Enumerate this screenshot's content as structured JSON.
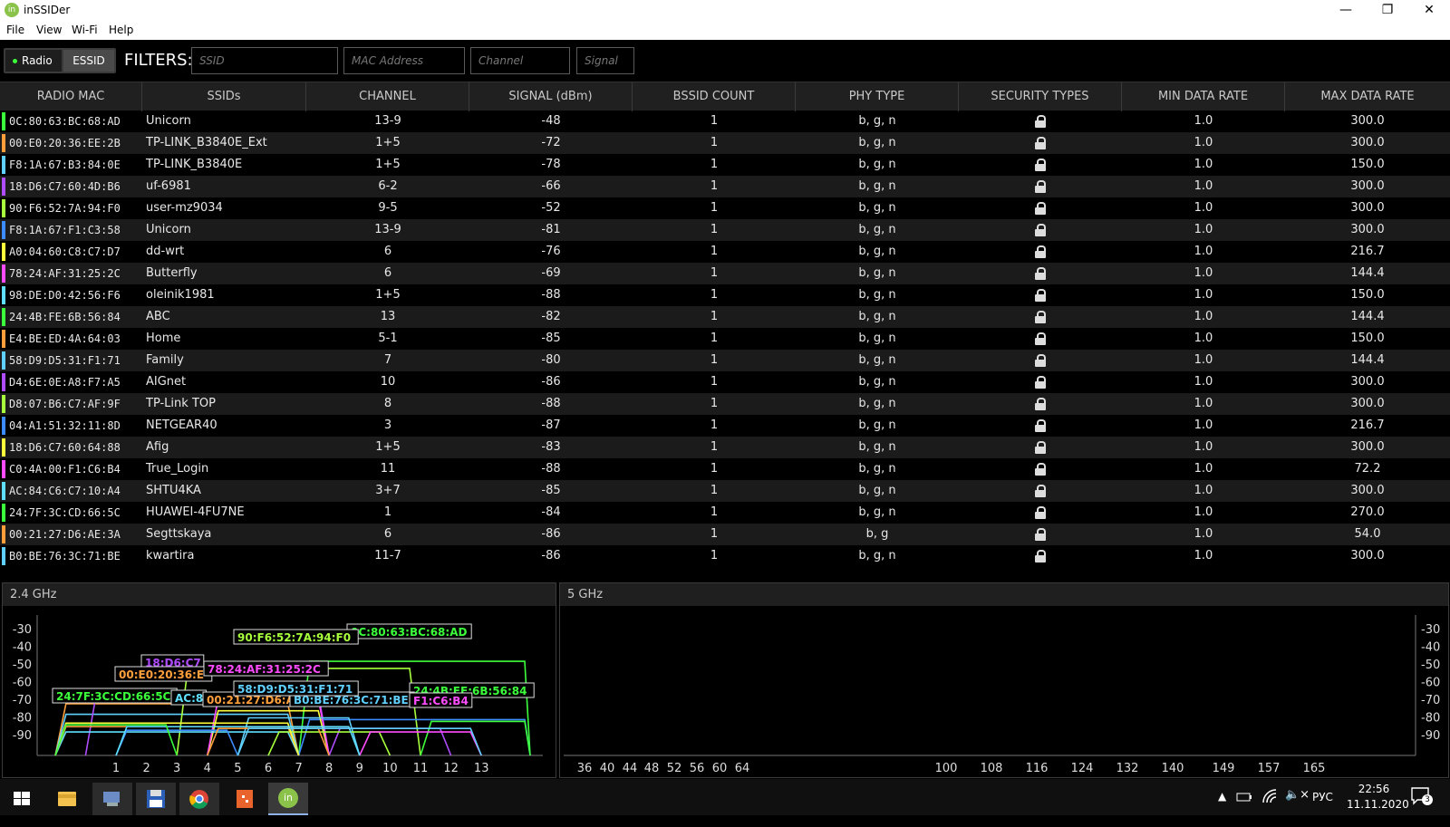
{
  "window": {
    "title": "inSSIDer",
    "icon_label": "in"
  },
  "menu": [
    "File",
    "View",
    "Wi-Fi",
    "Help"
  ],
  "toolbar": {
    "radio_label": "Radio",
    "essid_label": "ESSID",
    "filters_label": "FILTERS:",
    "ssid_placeholder": "SSID",
    "mac_placeholder": "MAC Address",
    "channel_placeholder": "Channel",
    "signal_placeholder": "Signal"
  },
  "columns": [
    "RADIO MAC",
    "SSIDs",
    "CHANNEL",
    "SIGNAL (dBm)",
    "BSSID COUNT",
    "PHY TYPE",
    "SECURITY TYPES",
    "MIN DATA RATE",
    "MAX DATA RATE"
  ],
  "rows": [
    {
      "mac": "0C:80:63:BC:68:AD",
      "ssid": "Unicorn",
      "channel": "13-9",
      "signal": "-48",
      "bssid": "1",
      "phy": "b, g, n",
      "min": "1.0",
      "max": "300.0",
      "color": "#3cff3c"
    },
    {
      "mac": "00:E0:20:36:EE:2B",
      "ssid": "TP-LINK_B3840E_Ext",
      "channel": "1+5",
      "signal": "-72",
      "bssid": "1",
      "phy": "b, g, n",
      "min": "1.0",
      "max": "300.0",
      "color": "#ff9f3c"
    },
    {
      "mac": "F8:1A:67:B3:84:0E",
      "ssid": "TP-LINK_B3840E",
      "channel": "1+5",
      "signal": "-78",
      "bssid": "1",
      "phy": "b, g, n",
      "min": "1.0",
      "max": "150.0",
      "color": "#5fd0ff"
    },
    {
      "mac": "18:D6:C7:60:4D:B6",
      "ssid": "uf-6981",
      "channel": "6-2",
      "signal": "-66",
      "bssid": "1",
      "phy": "b, g, n",
      "min": "1.0",
      "max": "300.0",
      "color": "#b04cff"
    },
    {
      "mac": "90:F6:52:7A:94:F0",
      "ssid": "user-mz9034",
      "channel": "9-5",
      "signal": "-52",
      "bssid": "1",
      "phy": "b, g, n",
      "min": "1.0",
      "max": "300.0",
      "color": "#a8ff3c"
    },
    {
      "mac": "F8:1A:67:F1:C3:58",
      "ssid": "Unicorn",
      "channel": "13-9",
      "signal": "-81",
      "bssid": "1",
      "phy": "b, g, n",
      "min": "1.0",
      "max": "300.0",
      "color": "#3c8cff"
    },
    {
      "mac": "A0:04:60:C8:C7:D7",
      "ssid": "dd-wrt",
      "channel": "6",
      "signal": "-76",
      "bssid": "1",
      "phy": "b, g, n",
      "min": "1.0",
      "max": "216.7",
      "color": "#ffff3c"
    },
    {
      "mac": "78:24:AF:31:25:2C",
      "ssid": "Butterfly",
      "channel": "6",
      "signal": "-69",
      "bssid": "1",
      "phy": "b, g, n",
      "min": "1.0",
      "max": "144.4",
      "color": "#ff4cff"
    },
    {
      "mac": "98:DE:D0:42:56:F6",
      "ssid": "oleinik1981",
      "channel": "1+5",
      "signal": "-88",
      "bssid": "1",
      "phy": "b, g, n",
      "min": "1.0",
      "max": "150.0",
      "color": "#5fe0ff"
    },
    {
      "mac": "24:4B:FE:6B:56:84",
      "ssid": "ABC",
      "channel": "13",
      "signal": "-82",
      "bssid": "1",
      "phy": "b, g, n",
      "min": "1.0",
      "max": "144.4",
      "color": "#3cff3c"
    },
    {
      "mac": "E4:BE:ED:4A:64:03",
      "ssid": "Home",
      "channel": "5-1",
      "signal": "-85",
      "bssid": "1",
      "phy": "b, g, n",
      "min": "1.0",
      "max": "150.0",
      "color": "#ff9f3c"
    },
    {
      "mac": "58:D9:D5:31:F1:71",
      "ssid": "Family",
      "channel": "7",
      "signal": "-80",
      "bssid": "1",
      "phy": "b, g, n",
      "min": "1.0",
      "max": "144.4",
      "color": "#5fd0ff"
    },
    {
      "mac": "D4:6E:0E:A8:F7:A5",
      "ssid": "AIGnet",
      "channel": "10",
      "signal": "-86",
      "bssid": "1",
      "phy": "b, g, n",
      "min": "1.0",
      "max": "300.0",
      "color": "#b04cff"
    },
    {
      "mac": "D8:07:B6:C7:AF:9F",
      "ssid": "TP-Link TOP",
      "channel": "8",
      "signal": "-88",
      "bssid": "1",
      "phy": "b, g, n",
      "min": "1.0",
      "max": "300.0",
      "color": "#a8ff3c"
    },
    {
      "mac": "04:A1:51:32:11:8D",
      "ssid": "NETGEAR40",
      "channel": "3",
      "signal": "-87",
      "bssid": "1",
      "phy": "b, g, n",
      "min": "1.0",
      "max": "216.7",
      "color": "#3c8cff"
    },
    {
      "mac": "18:D6:C7:60:64:88",
      "ssid": "Afig",
      "channel": "1+5",
      "signal": "-83",
      "bssid": "1",
      "phy": "b, g, n",
      "min": "1.0",
      "max": "300.0",
      "color": "#ffff3c"
    },
    {
      "mac": "C0:4A:00:F1:C6:B4",
      "ssid": "True_Login",
      "channel": "11",
      "signal": "-88",
      "bssid": "1",
      "phy": "b, g, n",
      "min": "1.0",
      "max": "72.2",
      "color": "#ff4cff"
    },
    {
      "mac": "AC:84:C6:C7:10:A4",
      "ssid": "SHTU4KA",
      "channel": "3+7",
      "signal": "-85",
      "bssid": "1",
      "phy": "b, g, n",
      "min": "1.0",
      "max": "300.0",
      "color": "#5fe0ff"
    },
    {
      "mac": "24:7F:3C:CD:66:5C",
      "ssid": "HUAWEI-4FU7NE",
      "channel": "1",
      "signal": "-84",
      "bssid": "1",
      "phy": "b, g, n",
      "min": "1.0",
      "max": "270.0",
      "color": "#3cff3c"
    },
    {
      "mac": "00:21:27:D6:AE:3A",
      "ssid": "Segttskaya",
      "channel": "6",
      "signal": "-86",
      "bssid": "1",
      "phy": "b, g",
      "min": "1.0",
      "max": "54.0",
      "color": "#ff9f3c"
    },
    {
      "mac": "B0:BE:76:3C:71:BE",
      "ssid": "kwartira",
      "channel": "11-7",
      "signal": "-86",
      "bssid": "1",
      "phy": "b, g, n",
      "min": "1.0",
      "max": "300.0",
      "color": "#5fd0ff"
    }
  ],
  "panels": {
    "ghz24": {
      "title": "2.4 GHz",
      "y_ticks": [
        "-30",
        "-40",
        "-50",
        "-60",
        "-70",
        "-80",
        "-90"
      ],
      "x_ticks": [
        "1",
        "2",
        "3",
        "4",
        "5",
        "6",
        "7",
        "8",
        "9",
        "10",
        "11",
        "12",
        "13"
      ],
      "labels": [
        {
          "text": "0C:80:63:BC:68:AD",
          "color": "#3cff3c"
        },
        {
          "text": "90:F6:52:7A:94:F0",
          "color": "#a8ff3c"
        },
        {
          "text": "18:D6:C7",
          "color": "#b04cff"
        },
        {
          "text": "00:E0:20:36:E",
          "color": "#ff9f3c"
        },
        {
          "text": "78:24:AF:31:25:2C",
          "color": "#ff4cff"
        },
        {
          "text": "24:4B:FE:6B:56:84",
          "color": "#3cff3c"
        },
        {
          "text": "24:7F:3C:CD:66:5C",
          "color": "#3cff3c"
        },
        {
          "text": "AC:8",
          "color": "#5fe0ff"
        },
        {
          "text": "00:21:27:D6:A",
          "color": "#ff9f3c"
        },
        {
          "text": "B0:BE:76:3C:71:BE",
          "color": "#5fd0ff"
        },
        {
          "text": "F1:C6:B4",
          "color": "#ff4cff"
        },
        {
          "text": "58:D9:D5:31:F1:71",
          "color": "#5fd0ff"
        }
      ]
    },
    "ghz5": {
      "title": "5 GHz",
      "y_ticks": [
        "-30",
        "-40",
        "-50",
        "-60",
        "-70",
        "-80",
        "-90"
      ],
      "x_ticks": [
        "36",
        "40",
        "44",
        "48",
        "52",
        "56",
        "60",
        "64",
        "100",
        "108",
        "116",
        "124",
        "132",
        "140",
        "149",
        "157",
        "165"
      ]
    }
  },
  "taskbar": {
    "language": "РУС",
    "time": "22:56",
    "date": "11.11.2020",
    "notifications": "3",
    "app_label": "in"
  }
}
